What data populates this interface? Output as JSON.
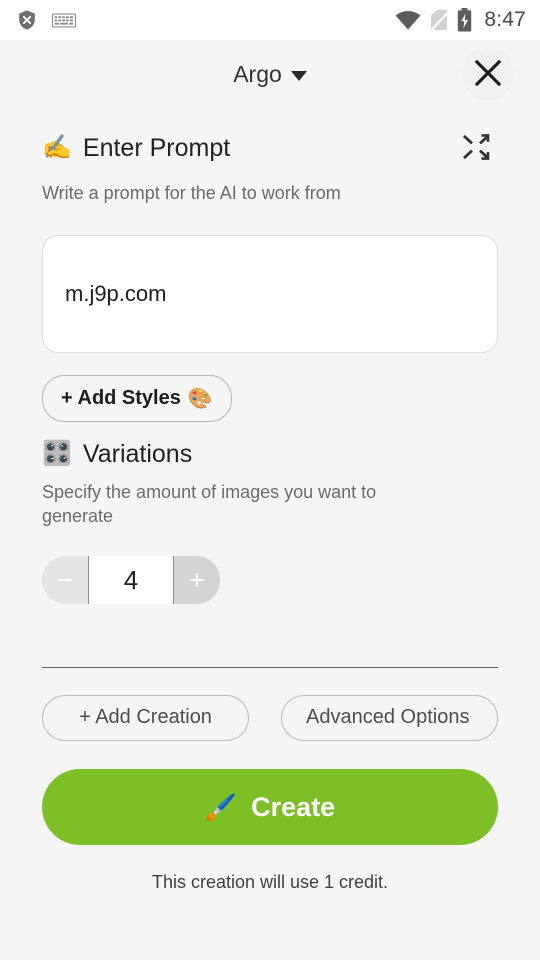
{
  "status_bar": {
    "icons": [
      "shield-x-icon",
      "keyboard-icon",
      "wifi-icon",
      "no-sim-icon",
      "battery-charging-icon"
    ],
    "time": "8:47"
  },
  "header": {
    "title": "Argo",
    "dropdown_icon": "chevron-down-icon",
    "close_icon": "close-icon"
  },
  "prompt_section": {
    "emoji": "✍️",
    "title": "Enter Prompt",
    "subtitle": "Write a prompt for the AI to work from",
    "shuffle_icon": "shuffle-icon",
    "input_value": "m.j9p.com",
    "input_placeholder": "",
    "add_styles_label": "+ Add Styles",
    "add_styles_emoji": "🎨"
  },
  "variations_section": {
    "emoji": "🎛️",
    "title": "Variations",
    "subtitle": "Specify the amount of images you want to generate",
    "decrement_label": "−",
    "value": "4",
    "increment_label": "+"
  },
  "footer": {
    "add_creation_label": "+ Add Creation",
    "advanced_options_label": "Advanced Options",
    "create_label": "Create",
    "create_emoji": "🖌️",
    "credit_note": "This creation will use 1 credit."
  },
  "colors": {
    "background": "#f5f5f5",
    "create_green": "#7cbf27",
    "status_bar_bg": "#ffffff",
    "divider": "#5f5f5f"
  }
}
